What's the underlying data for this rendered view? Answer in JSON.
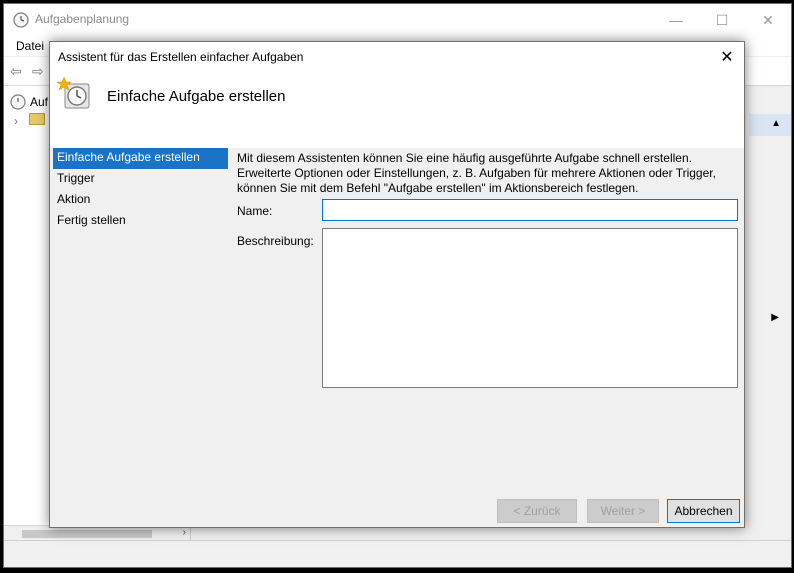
{
  "background_window": {
    "title": "Aufgabenplanung",
    "menu": [
      "Datei"
    ],
    "tree_item_partial": "Auf"
  },
  "dialog": {
    "title": "Assistent für das Erstellen einfacher Aufgaben",
    "header_title": "Einfache Aufgabe erstellen",
    "steps": [
      {
        "label": "Einfache Aufgabe erstellen",
        "active": true
      },
      {
        "label": "Trigger",
        "active": false
      },
      {
        "label": "Aktion",
        "active": false
      },
      {
        "label": "Fertig stellen",
        "active": false
      }
    ],
    "intro_lines": [
      "Mit diesem Assistenten können Sie eine häufig ausgeführte Aufgabe schnell erstellen.",
      "Erweiterte Optionen oder Einstellungen, z. B. Aufgaben für mehrere Aktionen oder Trigger,",
      "können Sie mit dem Befehl \"Aufgabe erstellen\" im Aktionsbereich festlegen."
    ],
    "name_label": "Name:",
    "name_value": "",
    "description_label": "Beschreibung:",
    "description_value": "",
    "buttons": {
      "back": "< Zurück",
      "next": "Weiter >",
      "cancel": "Abbrechen"
    }
  },
  "icons": {
    "app": "clock-icon",
    "wizard": "task-wizard-icon",
    "close": "close-icon"
  },
  "colors": {
    "accent": "#0078d7",
    "selected_step": "#1a73c7"
  }
}
